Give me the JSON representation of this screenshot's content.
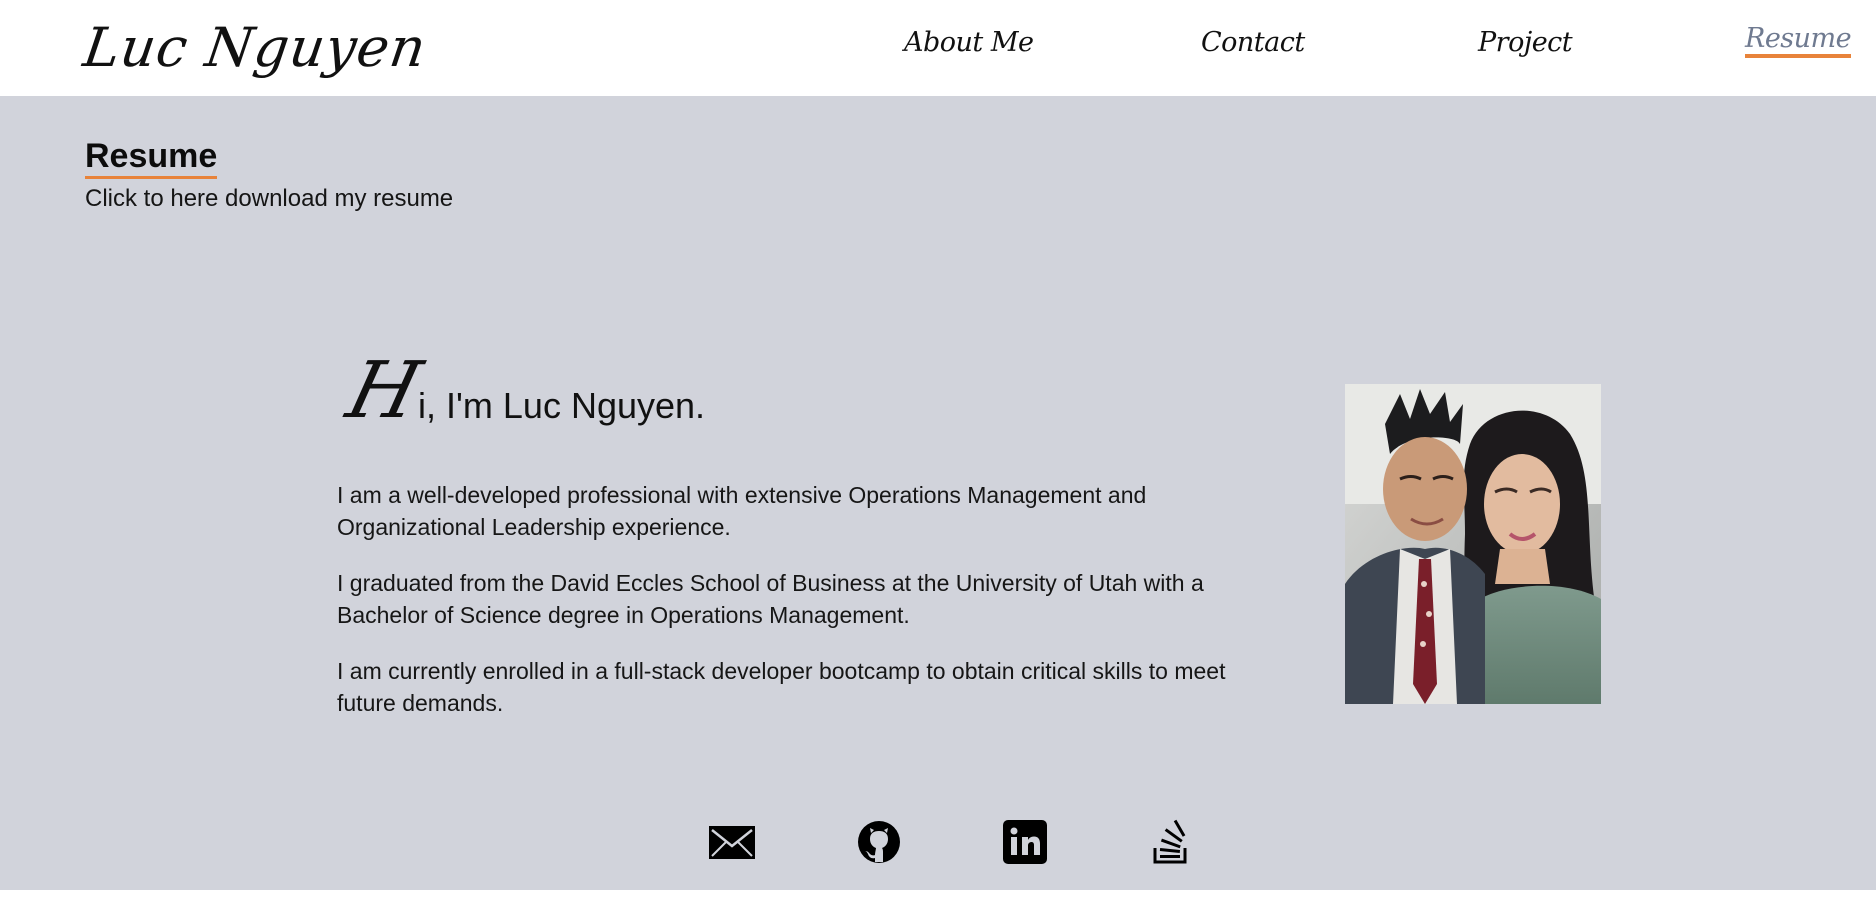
{
  "header": {
    "brand": "Luc Nguyen",
    "nav": [
      {
        "label": "About Me"
      },
      {
        "label": "Contact"
      },
      {
        "label": "Project"
      },
      {
        "label": "Resume",
        "active": true
      }
    ]
  },
  "main": {
    "section_title": "Resume",
    "download_text": "Click to here download my resume",
    "greeting_initial": "H",
    "greeting_rest": "i, I'm Luc Nguyen.",
    "bio": [
      "I am a well-developed professional with extensive Operations Management and Organizational Leadership experience.",
      "I graduated from the David Eccles School of Business at the University of Utah with a Bachelor of Science degree in Operations Management.",
      "I am currently enrolled in a full-stack developer bootcamp to obtain critical skills to meet future demands."
    ],
    "photo_icon": "portrait-photo"
  },
  "social": [
    {
      "icon": "envelope-icon"
    },
    {
      "icon": "github-icon"
    },
    {
      "icon": "linkedin-icon"
    },
    {
      "icon": "stackoverflow-icon"
    }
  ],
  "colors": {
    "accent": "#e8833a",
    "page_bg": "#d1d3db",
    "header_bg": "#ffffff",
    "active_nav": "#6f7a90"
  }
}
